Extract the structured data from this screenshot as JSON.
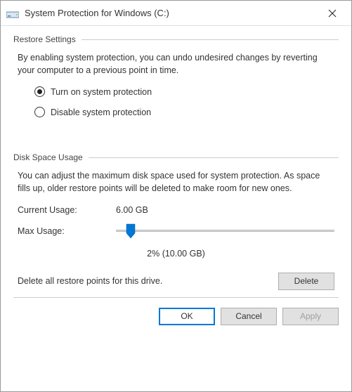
{
  "window": {
    "title": "System Protection for Windows (C:)"
  },
  "restoreSettings": {
    "header": "Restore Settings",
    "description": "By enabling system protection, you can undo undesired changes by reverting your computer to a previous point in time.",
    "options": {
      "turnOn": "Turn on system protection",
      "disable": "Disable system protection"
    }
  },
  "diskSpace": {
    "header": "Disk Space Usage",
    "description": "You can adjust the maximum disk space used for system protection. As space fills up, older restore points will be deleted to make room for new ones.",
    "currentUsageLabel": "Current Usage:",
    "currentUsageValue": "6.00 GB",
    "maxUsageLabel": "Max Usage:",
    "sliderText": "2% (10.00 GB)",
    "deleteText": "Delete all restore points for this drive."
  },
  "buttons": {
    "delete": "Delete",
    "ok": "OK",
    "cancel": "Cancel",
    "apply": "Apply"
  }
}
